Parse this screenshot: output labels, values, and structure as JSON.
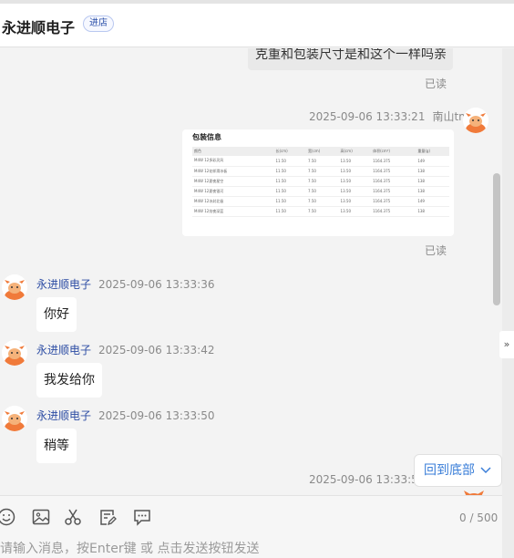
{
  "header": {
    "shop_name": "永进顺电子",
    "enter_shop": "进店"
  },
  "messages": {
    "cut_bubble_text": "克重和包装尺寸是和这个一样吗亲",
    "read1": "已读",
    "img_msg": {
      "time": "2025-09-06 13:33:21",
      "nick": "南山tm",
      "read": "已读",
      "table": {
        "title": "包装信息",
        "headers": [
          "颜色",
          "长(cm)",
          "宽(cm)",
          "高(cm)",
          "体积(cm³)",
          "重量(g)"
        ],
        "rows": [
          [
            "M4W 12多彩灵风",
            "11.50",
            "7.50",
            "13.50",
            "1164.375",
            "149"
          ],
          [
            "M4W 12花样滑冰板",
            "11.50",
            "7.50",
            "13.50",
            "1164.375",
            "138"
          ],
          [
            "M4W 12夏夜星空",
            "11.50",
            "7.50",
            "13.50",
            "1164.375",
            "138"
          ],
          [
            "M4W 12夏夜银河",
            "11.50",
            "7.50",
            "13.50",
            "1164.375",
            "138"
          ],
          [
            "M4W 12冰封北极",
            "11.50",
            "7.50",
            "13.50",
            "1164.375",
            "149"
          ],
          [
            "M4W 12炫夜深蓝",
            "11.50",
            "7.50",
            "13.50",
            "1164.375",
            "138"
          ]
        ]
      }
    },
    "seller1": {
      "nick": "永进顺电子",
      "time": "2025-09-06 13:33:36",
      "text": "你好"
    },
    "seller2": {
      "nick": "永进顺电子",
      "time": "2025-09-06 13:33:42",
      "text": "我发给你"
    },
    "seller3": {
      "nick": "永进顺电子",
      "time": "2025-09-06 13:33:50",
      "text": "稍等"
    },
    "last_time": "2025-09-06 13:33:50"
  },
  "back_to_bottom": "回到底部",
  "input": {
    "counter": "0 / 500",
    "placeholder": "请输入消息，按Enter键 或 点击发送按钮发送"
  },
  "toolbar": {
    "icons": [
      "emoji-icon",
      "image-icon",
      "scissors-icon",
      "edit-note-icon",
      "quick-reply-icon"
    ]
  },
  "colors": {
    "nick_blue": "#2d4da4",
    "link_blue": "#3a7ed8",
    "avatar_orange": "#f07a3a"
  }
}
